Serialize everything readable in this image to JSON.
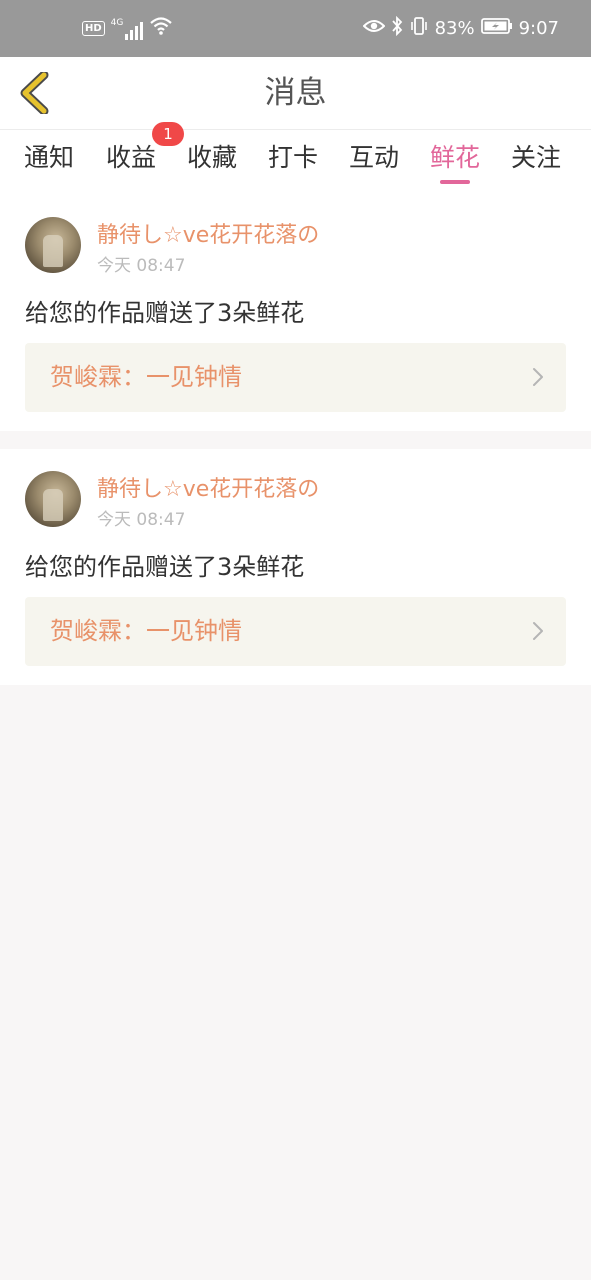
{
  "status_bar": {
    "hd_label": "HD",
    "network_label": "4G",
    "battery_text": "83%",
    "time": "9:07"
  },
  "header": {
    "title": "消息",
    "back_icon": "chevron-left-icon"
  },
  "tabs": [
    {
      "label": "通知",
      "active": false
    },
    {
      "label": "收益",
      "active": false,
      "badge": "1"
    },
    {
      "label": "收藏",
      "active": false
    },
    {
      "label": "打卡",
      "active": false
    },
    {
      "label": "互动",
      "active": false
    },
    {
      "label": "鲜花",
      "active": true
    },
    {
      "label": "关注",
      "active": false
    }
  ],
  "messages": [
    {
      "username": "静待し☆ve花开花落の",
      "time": "今天 08:47",
      "text": "给您的作品赠送了3朵鲜花",
      "work_title": "贺峻霖：一见钟情"
    },
    {
      "username": "静待し☆ve花开花落の",
      "time": "今天 08:47",
      "text": "给您的作品赠送了3朵鲜花",
      "work_title": "贺峻霖：一见钟情"
    }
  ],
  "colors": {
    "accent": "#e2679a",
    "username": "#e8926a",
    "badge": "#f04848",
    "back_icon": "#e6c22e",
    "status_bar": "#999999"
  }
}
